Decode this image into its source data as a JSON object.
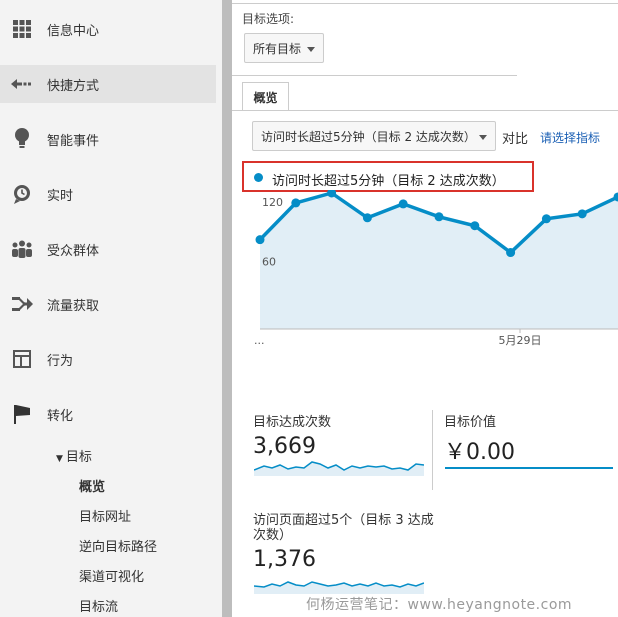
{
  "sidebar": {
    "items": [
      {
        "label": "信息中心",
        "icon": "grid-icon"
      },
      {
        "label": "快捷方式",
        "icon": "shortcut-arrow-icon"
      },
      {
        "label": "智能事件",
        "icon": "lightbulb-icon"
      },
      {
        "label": "实时",
        "icon": "clock-icon"
      },
      {
        "label": "受众群体",
        "icon": "people-icon"
      },
      {
        "label": "流量获取",
        "icon": "merge-arrow-icon"
      },
      {
        "label": "行为",
        "icon": "layout-icon"
      },
      {
        "label": "转化",
        "icon": "flag-icon"
      }
    ],
    "goals_parent": "目标",
    "goals_children": [
      "概览",
      "目标网址",
      "逆向目标路径",
      "渠道可视化",
      "目标流"
    ]
  },
  "main": {
    "goal_options_label": "目标选项:",
    "goal_select_value": "所有目标",
    "tab_overview": "概览",
    "metric_select_value": "访问时长超过5分钟（目标 2 达成次数）",
    "compare_label": "对比",
    "choose_metric_link": "请选择指标",
    "legend_label": "访问时长超过5分钟（目标 2 达成次数）",
    "accent_color": "#058dc7",
    "highlight_color": "#d9322b"
  },
  "chart_data": {
    "type": "area",
    "y_tick_labels": [
      "120",
      "60"
    ],
    "x_tick_labels": [
      "...",
      "5月29日"
    ],
    "ylim": [
      0,
      140
    ],
    "values": [
      90,
      127,
      137,
      112,
      126,
      113,
      104,
      77,
      111,
      116,
      133
    ],
    "grid": true
  },
  "stats": {
    "goal_completions": {
      "label": "目标达成次数",
      "value": "3,669"
    },
    "goal_value": {
      "label": "目标价值",
      "value": "￥0.00"
    },
    "pages_goal": {
      "label": "访问页面超过5个（目标 3 达成次数）",
      "value": "1,376"
    }
  },
  "watermark": "何杨运营笔记：www.heyangnote.com"
}
